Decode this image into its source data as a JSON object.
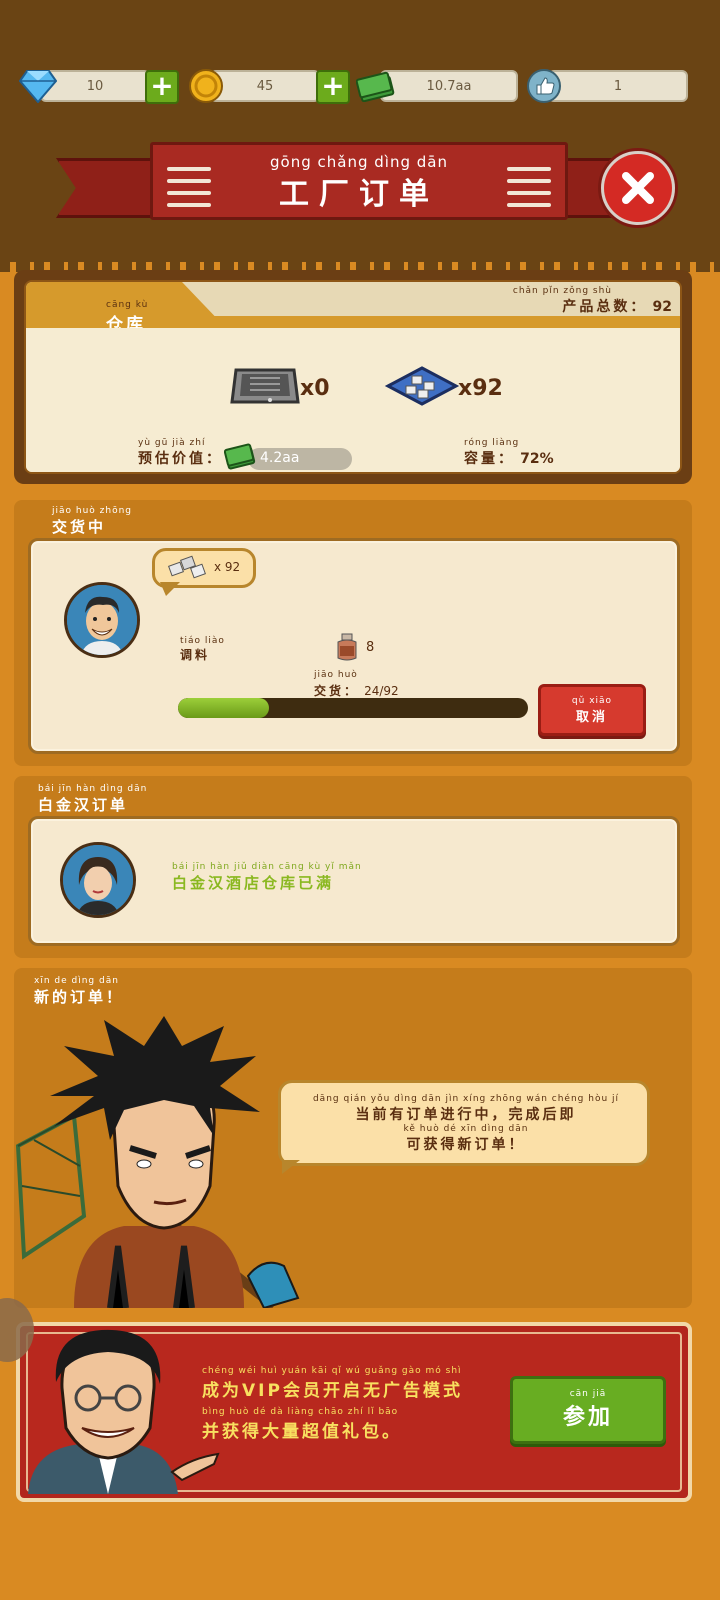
{
  "resources": {
    "diamonds": "10",
    "coins": "45",
    "cash": "10.7aa",
    "likes": "1"
  },
  "banner": {
    "pinyin": "gōng chǎng dìng dān",
    "title": "工厂订单"
  },
  "warehouse": {
    "title_pinyin": "cāng kù",
    "title": "仓库",
    "total_pinyin": "chǎn pǐn zǒng shù",
    "total_label": "产品总数：",
    "total_value": "92",
    "item1_count": "x0",
    "item2_count": "x92",
    "est_pinyin": "yù gū jià zhí",
    "est_label": "预估价值：",
    "est_value": "4.2aa",
    "capacity_pinyin": "róng liàng",
    "capacity_label": "容量：",
    "capacity_value": "72%"
  },
  "delivering": {
    "title_pinyin": "jiāo huò zhōng",
    "title": "交货中",
    "bubble_count": "x 92",
    "ingredient_pinyin": "tiáo liào",
    "ingredient_label": "调料",
    "ingredient_count": "8",
    "progress_pinyin": "jiāo huò",
    "progress_label": "交货：",
    "progress_value": "24/92",
    "progress_fraction": 0.26,
    "cancel_pinyin": "qǔ xiāo",
    "cancel_label": "取消"
  },
  "platinum": {
    "title_pinyin": "bái jīn hàn dìng dān",
    "title": "白金汉订单",
    "message_pinyin": "bái jīn hàn jiǔ diàn cāng kù yǐ mǎn",
    "message": "白金汉酒店仓库已满"
  },
  "new_order": {
    "title_pinyin": "xīn de dìng dān",
    "title": "新的订单！",
    "msg_line1_pinyin": "dāng qián yǒu dìng dān jìn xíng zhōng   wán chéng hòu jí",
    "msg_line1": "当前有订单进行中，完成后即",
    "msg_line2_pinyin": "kě huò dé xīn dìng dān",
    "msg_line2": "可获得新订单！"
  },
  "vip": {
    "line1_pinyin": "chéng wéi   huì yuán kāi qǐ wú guǎng gào mó shì",
    "line1": "成为VIP会员开启无广告模式",
    "line2_pinyin": "bìng huò dé dà liàng chāo zhí lǐ bāo",
    "line2": "并获得大量超值礼包。",
    "join_pinyin": "cān jiā",
    "join_label": "参加"
  },
  "colors": {
    "background": "#d98a22",
    "top_band": "#6a4414",
    "banner_red": "#a92a22",
    "accent_green": "#68ad22",
    "accent_red": "#d63a2e"
  }
}
